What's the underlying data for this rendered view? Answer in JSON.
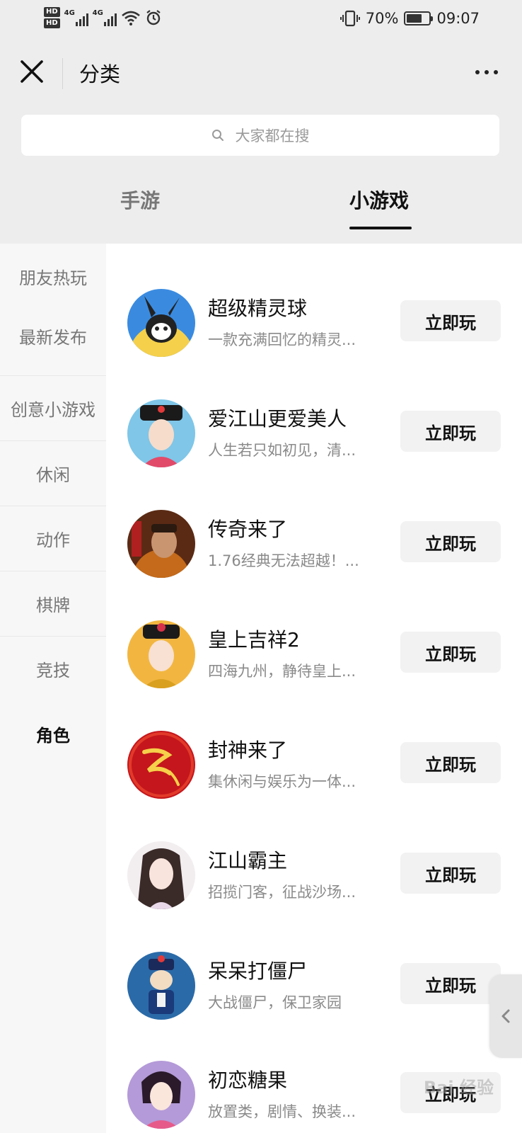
{
  "status_bar": {
    "hd1": "HD",
    "hd2": "HD",
    "net1": "4G",
    "net2": "4G",
    "battery_percent": "70%",
    "time": "09:07"
  },
  "nav": {
    "title": "分类"
  },
  "search": {
    "placeholder": "大家都在搜"
  },
  "tabs": [
    {
      "label": "手游",
      "active": false
    },
    {
      "label": "小游戏",
      "active": true
    }
  ],
  "sidebar": {
    "items": [
      {
        "label": "朋友热玩"
      },
      {
        "label": "最新发布"
      },
      {
        "label": "创意小游戏"
      },
      {
        "label": "休闲"
      },
      {
        "label": "动作"
      },
      {
        "label": "棋牌"
      },
      {
        "label": "竞技"
      },
      {
        "label": "角色",
        "active": true
      }
    ]
  },
  "games": [
    {
      "name": "超级精灵球",
      "desc": "一款充满回忆的精灵...",
      "button": "立即玩",
      "icon": "rabbit-mascot-icon"
    },
    {
      "name": "爱江山更爱美人",
      "desc": "人生若只如初见，清...",
      "button": "立即玩",
      "icon": "qing-lady-icon"
    },
    {
      "name": "传奇来了",
      "desc": "1.76经典无法超越！...",
      "button": "立即玩",
      "icon": "warrior-portrait-icon"
    },
    {
      "name": "皇上吉祥2",
      "desc": "四海九州，静待皇上...",
      "button": "立即玩",
      "icon": "empress-portrait-icon"
    },
    {
      "name": "封神来了",
      "desc": "集休闲与娱乐为一体...",
      "button": "立即玩",
      "icon": "fengshen-logo-icon"
    },
    {
      "name": "江山霸主",
      "desc": "招揽门客，征战沙场...",
      "button": "立即玩",
      "icon": "lady-portrait-icon"
    },
    {
      "name": "呆呆打僵尸",
      "desc": "大战僵尸，保卫家园",
      "button": "立即玩",
      "icon": "zombie-character-icon"
    },
    {
      "name": "初恋糖果",
      "desc": "放置类，剧情、换装...",
      "button": "立即玩",
      "icon": "anime-girl-icon"
    }
  ],
  "watermark": "Bai 经验"
}
